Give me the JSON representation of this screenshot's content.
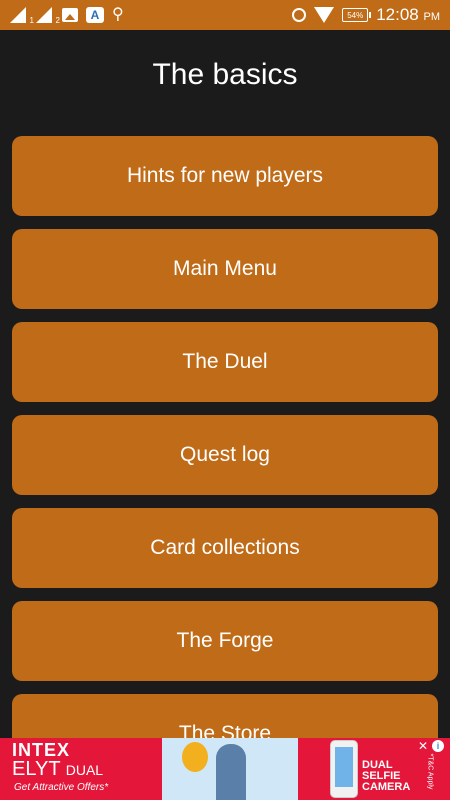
{
  "status_bar": {
    "sim1": "1",
    "sim2": "2",
    "battery": "54%",
    "time": "12:08",
    "ampm": "PM"
  },
  "title": "The basics",
  "menu": [
    {
      "label": "Hints for new players"
    },
    {
      "label": "Main Menu"
    },
    {
      "label": "The Duel"
    },
    {
      "label": "Quest log"
    },
    {
      "label": "Card collections"
    },
    {
      "label": "The Forge"
    },
    {
      "label": "The Store"
    }
  ],
  "ad": {
    "brand": "INTEX",
    "model": "ELYT",
    "model_suffix": "DUAL",
    "offers": "Get Attractive Offers*",
    "feature_line1": "DUAL",
    "feature_line2": "SELFIE",
    "feature_line3": "CAMERA",
    "tc": "*T&C Apply",
    "info": "i"
  },
  "colors": {
    "accent": "#c06b17",
    "background": "#1b1b1b",
    "ad_background": "#e4173b"
  }
}
